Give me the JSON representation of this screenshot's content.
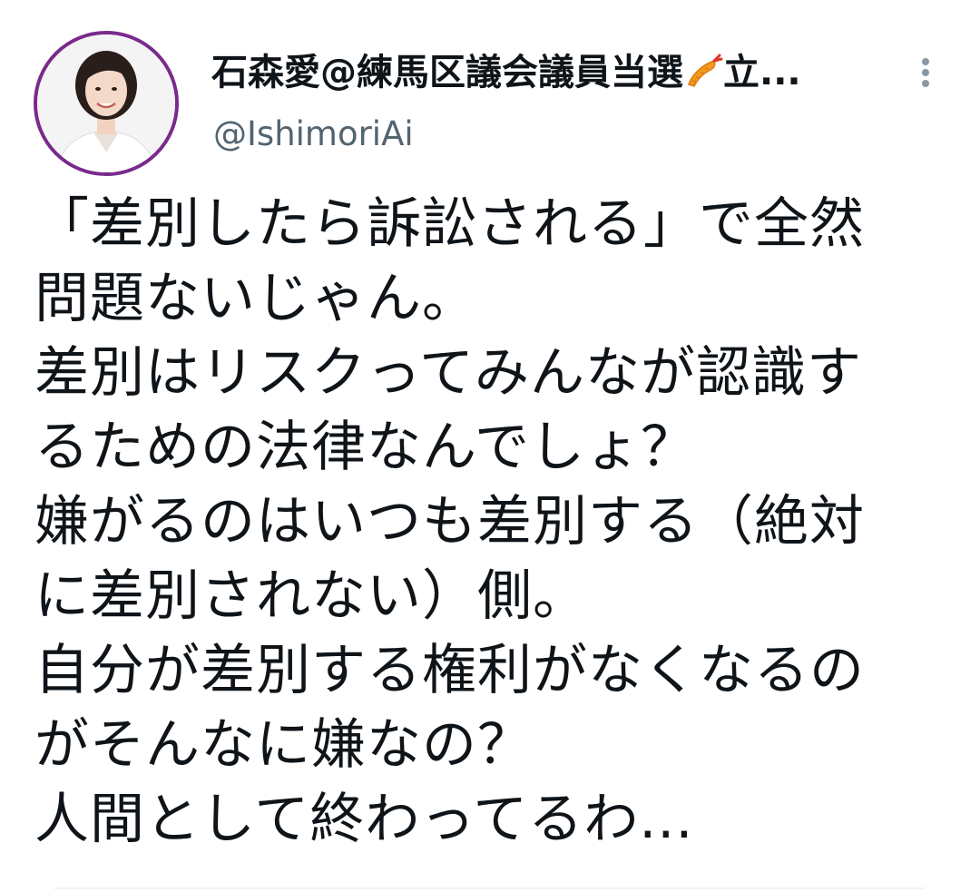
{
  "author": {
    "display_name": "石森愛@練馬区議会議員当選",
    "display_name_suffix": "立...",
    "handle": "@IshimoriAi",
    "name_emoji": "fried-shrimp-icon",
    "avatar_border_color": "#7a2a8c"
  },
  "tweet": {
    "lines": [
      "「差別したら訴訟される」で全然",
      "問題ないじゃん。",
      "差別はリスクってみんなが認識す",
      "るための法律なんでしょ？",
      "嫌がるのはいつも差別する（絶対",
      "に差別されない）側。",
      "自分が差別する権利がなくなるの",
      "がそんなに嫌なの？",
      "人間として終わってるわ..."
    ]
  },
  "colors": {
    "text": "#0f1419",
    "secondary_text": "#536471",
    "more_icon": "#8a98a5"
  }
}
